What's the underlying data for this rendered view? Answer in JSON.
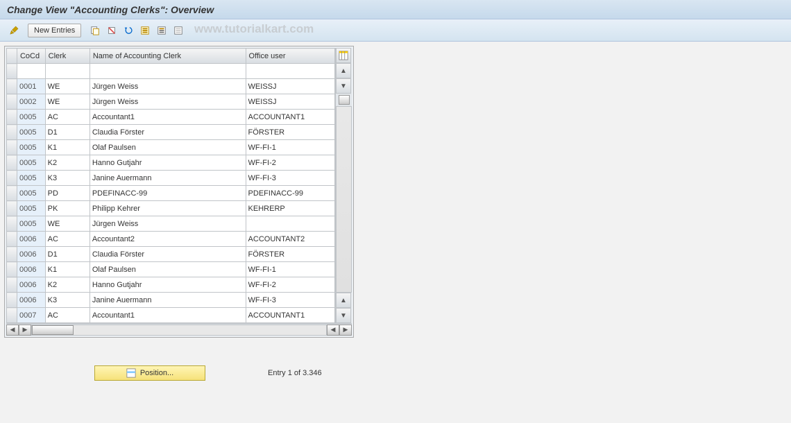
{
  "title": "Change View \"Accounting Clerks\": Overview",
  "toolbar": {
    "new_entries": "New Entries"
  },
  "watermark": "www.tutorialkart.com",
  "columns": {
    "cocd": "CoCd",
    "clerk": "Clerk",
    "name": "Name of Accounting Clerk",
    "office_user": "Office user"
  },
  "rows": [
    {
      "cocd": "0001",
      "clerk": "WE",
      "name": "Jürgen Weiss",
      "user": "WEISSJ"
    },
    {
      "cocd": "0002",
      "clerk": "WE",
      "name": "Jürgen Weiss",
      "user": "WEISSJ"
    },
    {
      "cocd": "0005",
      "clerk": "AC",
      "name": "Accountant1",
      "user": "ACCOUNTANT1"
    },
    {
      "cocd": "0005",
      "clerk": "D1",
      "name": "Claudia Förster",
      "user": "FÖRSTER"
    },
    {
      "cocd": "0005",
      "clerk": "K1",
      "name": "Olaf Paulsen",
      "user": "WF-FI-1"
    },
    {
      "cocd": "0005",
      "clerk": "K2",
      "name": "Hanno Gutjahr",
      "user": "WF-FI-2"
    },
    {
      "cocd": "0005",
      "clerk": "K3",
      "name": "Janine Auermann",
      "user": "WF-FI-3"
    },
    {
      "cocd": "0005",
      "clerk": "PD",
      "name": "PDEFINACC-99",
      "user": "PDEFINACC-99"
    },
    {
      "cocd": "0005",
      "clerk": "PK",
      "name": "Philipp Kehrer",
      "user": "KEHRERP"
    },
    {
      "cocd": "0005",
      "clerk": "WE",
      "name": "Jürgen Weiss",
      "user": ""
    },
    {
      "cocd": "0006",
      "clerk": "AC",
      "name": "Accountant2",
      "user": "ACCOUNTANT2"
    },
    {
      "cocd": "0006",
      "clerk": "D1",
      "name": "Claudia Förster",
      "user": "FÖRSTER"
    },
    {
      "cocd": "0006",
      "clerk": "K1",
      "name": "Olaf Paulsen",
      "user": "WF-FI-1"
    },
    {
      "cocd": "0006",
      "clerk": "K2",
      "name": "Hanno Gutjahr",
      "user": "WF-FI-2"
    },
    {
      "cocd": "0006",
      "clerk": "K3",
      "name": "Janine Auermann",
      "user": "WF-FI-3"
    },
    {
      "cocd": "0007",
      "clerk": "AC",
      "name": "Accountant1",
      "user": "ACCOUNTANT1"
    }
  ],
  "footer": {
    "position": "Position...",
    "entry_status": "Entry 1 of 3.346"
  }
}
